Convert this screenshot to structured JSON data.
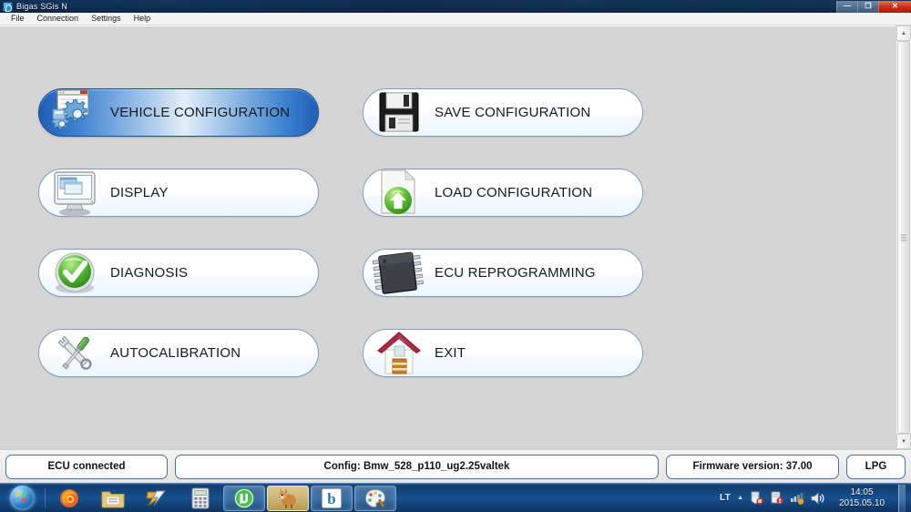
{
  "window": {
    "title": "Bigas SGis N",
    "icon": "app-icon",
    "controls": {
      "minimize": "—",
      "maximize": "❐",
      "close": "✕"
    }
  },
  "menubar": {
    "items": [
      {
        "label": "File"
      },
      {
        "label": "Connection"
      },
      {
        "label": "Settings"
      },
      {
        "label": "Help"
      }
    ]
  },
  "main": {
    "buttons": [
      {
        "id": "vehicle-configuration",
        "label": "VEHICLE CONFIGURATION",
        "icon": "window-gears-icon",
        "state": "active",
        "column": 0,
        "row": 0
      },
      {
        "id": "display",
        "label": "DISPLAY",
        "icon": "monitor-icon",
        "state": "normal",
        "column": 0,
        "row": 1
      },
      {
        "id": "diagnosis",
        "label": "DIAGNOSIS",
        "icon": "green-check-icon",
        "state": "normal",
        "column": 0,
        "row": 2
      },
      {
        "id": "autocalibration",
        "label": "AUTOCALIBRATION",
        "icon": "tools-icon",
        "state": "normal",
        "column": 0,
        "row": 3
      },
      {
        "id": "save-configuration",
        "label": "SAVE CONFIGURATION",
        "icon": "floppy-disk-icon",
        "state": "normal",
        "column": 1,
        "row": 0
      },
      {
        "id": "load-configuration",
        "label": "LOAD CONFIGURATION",
        "icon": "document-up-arrow-icon",
        "state": "normal",
        "column": 1,
        "row": 1
      },
      {
        "id": "ecu-reprogramming",
        "label": "ECU REPROGRAMMING",
        "icon": "microchip-icon",
        "state": "normal",
        "column": 1,
        "row": 2
      },
      {
        "id": "exit",
        "label": "EXIT",
        "icon": "house-icon",
        "state": "normal",
        "column": 1,
        "row": 3
      }
    ]
  },
  "statusbar": {
    "ecu_status": "ECU connected",
    "config": "Config: Bmw_528_p110_ug2.25valtek",
    "firmware": "Firmware version: 37.00",
    "fuel_mode": "LPG"
  },
  "scrollbar": {
    "up_arrow": "▲",
    "down_arrow": "▼"
  },
  "taskbar": {
    "start": "start-orb",
    "items": [
      {
        "name": "firefox",
        "state": "pinned"
      },
      {
        "name": "explorer",
        "state": "pinned"
      },
      {
        "name": "winamp",
        "state": "pinned"
      },
      {
        "name": "calculator",
        "state": "pinned"
      },
      {
        "name": "utorrent",
        "state": "open"
      },
      {
        "name": "amule",
        "state": "hot"
      },
      {
        "name": "b-app",
        "state": "open"
      },
      {
        "name": "paint",
        "state": "open"
      }
    ],
    "tray": {
      "language": "LT",
      "chevron": "▲",
      "icons": [
        "security-icon",
        "update-icon",
        "network-icon",
        "volume-icon"
      ],
      "time": "14:05",
      "date": "2015.05.10"
    }
  },
  "colors": {
    "accent_blue": "#1f5fb5",
    "button_border": "#7d9dc4",
    "panel_border": "#4a6f9e",
    "client_bg": "#d4d4d4",
    "close_red": "#c9331c"
  }
}
